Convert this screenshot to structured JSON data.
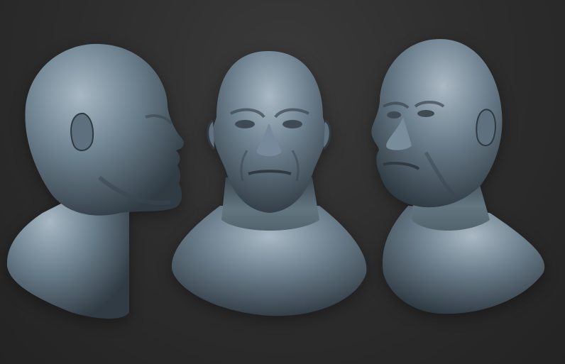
{
  "scene": {
    "views": [
      {
        "name": "left-profile"
      },
      {
        "name": "front"
      },
      {
        "name": "three-quarter-right"
      }
    ]
  },
  "colors": {
    "background": "#2b2b2b",
    "clay_base": "#6c7f8d",
    "clay_highlight": "#a8b8c4",
    "clay_shadow": "#2f3a42"
  }
}
